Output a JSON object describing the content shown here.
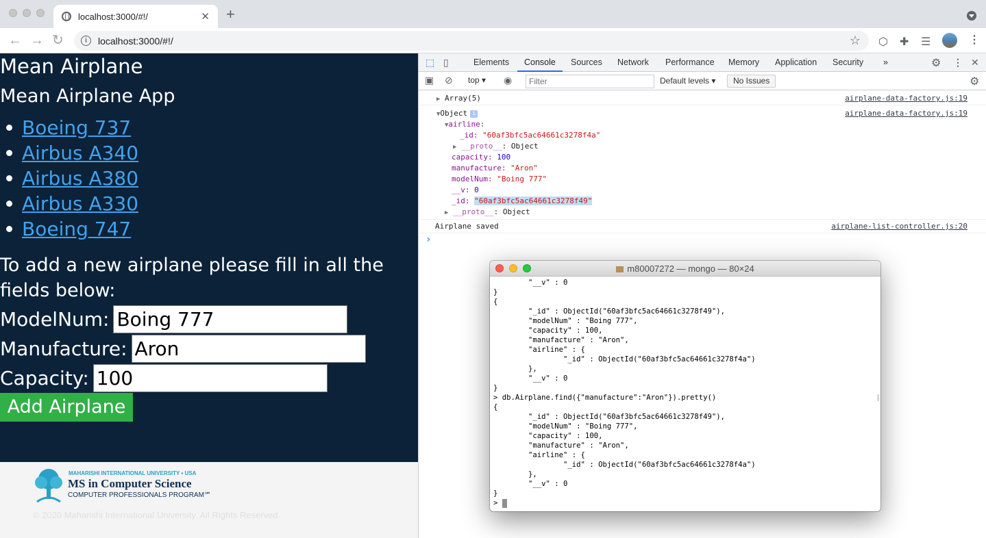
{
  "browser": {
    "tab_title": "localhost:3000/#!/",
    "url": "localhost:3000/#!/"
  },
  "page": {
    "heading": "Mean Airplane",
    "subheading": "Mean Airplane App",
    "airplanes": [
      "Boeing 737",
      "Airbus A340",
      "Airbus A380",
      "Airbus A330",
      "Boeing 747"
    ],
    "intro": "To add a new airplane please fill in all the fields below:",
    "form": {
      "model_label": "ModelNum:",
      "model_value": "Boing 777",
      "manufacture_label": "Manufacture:",
      "manufacture_value": "Aron",
      "capacity_label": "Capacity:",
      "capacity_value": "100",
      "submit_label": "Add Airplane"
    },
    "footer": {
      "university": "MAHARISHI INTERNATIONAL UNIVERSITY • USA",
      "program_title": "MS in Computer Science",
      "program_sub": "COMPUTER PROFESSIONALS PROGRAM℠",
      "copyright": "© 2020 Maharishi International University. All Rights Reserved."
    }
  },
  "devtools": {
    "tabs": [
      "Elements",
      "Console",
      "Sources",
      "Network",
      "Performance",
      "Memory",
      "Application",
      "Security",
      "»"
    ],
    "active_tab": "Console",
    "context": "top",
    "filter_placeholder": "Filter",
    "levels": "Default levels",
    "issues": "No Issues",
    "console": {
      "array_line": "Array(5)",
      "array_src": "airplane-data-factory.js:19",
      "object_line": "Object",
      "object_src": "airplane-data-factory.js:19",
      "airline_key": "airline:",
      "airline_id_key": "_id: ",
      "airline_id_val": "\"60af3bfc5ac64661c3278f4a\"",
      "proto_key": "__proto__",
      "proto_val": ": Object",
      "capacity_key": "capacity: ",
      "capacity_val": "100",
      "manufacture_key": "manufacture: ",
      "manufacture_val": "\"Aron\"",
      "modelnum_key": "modelNum: ",
      "modelnum_val": "\"Boing 777\"",
      "v_key": "__v: ",
      "v_val": "0",
      "id_key": "_id: ",
      "id_val": "\"60af3bfc5ac64661c3278f49\"",
      "saved_line": "Airplane saved",
      "saved_src": "airplane-list-controller.js:20",
      "prompt": "›"
    }
  },
  "terminal": {
    "title": "m80007272 — mongo — 80×24",
    "lines": [
      "        \"__v\" : 0",
      "}",
      "{",
      "        \"_id\" : ObjectId(\"60af3bfc5ac64661c3278f49\"),",
      "        \"modelNum\" : \"Boing 777\",",
      "        \"capacity\" : 100,",
      "        \"manufacture\" : \"Aron\",",
      "        \"airline\" : {",
      "                \"_id\" : ObjectId(\"60af3bfc5ac64661c3278f4a\")",
      "        },",
      "        \"__v\" : 0",
      "}",
      "> db.Airplane.find({\"manufacture\":\"Aron\"}).pretty()",
      "{",
      "        \"_id\" : ObjectId(\"60af3bfc5ac64661c3278f49\"),",
      "        \"modelNum\" : \"Boing 777\",",
      "        \"capacity\" : 100,",
      "        \"manufacture\" : \"Aron\",",
      "        \"airline\" : {",
      "                \"_id\" : ObjectId(\"60af3bfc5ac64661c3278f4a\")",
      "        },",
      "        \"__v\" : 0",
      "}",
      "> "
    ]
  }
}
